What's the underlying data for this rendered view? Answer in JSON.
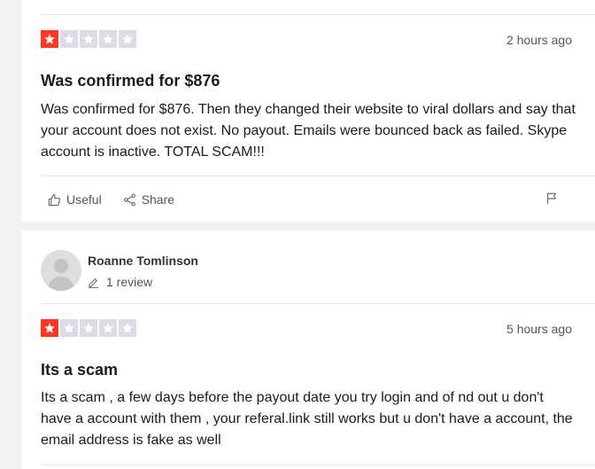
{
  "reviews": [
    {
      "rating": 1,
      "max_rating": 5,
      "date": "2 hours ago",
      "title": "Was confirmed for $876",
      "body": "Was confirmed for $876. Then they changed their website to viral dollars and say that your account does not exist. No payout. Emails were bounced back as failed. Skype account is inactive. TOTAL SCAM!!!",
      "actions": {
        "useful_label": "Useful",
        "share_label": "Share"
      }
    },
    {
      "reviewer": {
        "name": "Roanne Tomlinson",
        "review_count": "1 review"
      },
      "rating": 1,
      "max_rating": 5,
      "date": "5 hours ago",
      "title": "Its a scam",
      "body": "Its a scam , a few days before the payout date you try login and of nd out u don't have a account with them , your referal.link still works but u don't have a account, the email address is fake as well"
    }
  ],
  "colors": {
    "star_filled": "#ff3722",
    "star_empty": "#dcdce6",
    "page_background": "#f1f1f3",
    "card_background": "#ffffff"
  },
  "icons": {
    "star": "star-icon",
    "useful": "thumbs-up-icon",
    "share": "share-icon",
    "report": "flag-icon",
    "avatar": "user-avatar-icon",
    "review_count": "pencil-icon"
  }
}
